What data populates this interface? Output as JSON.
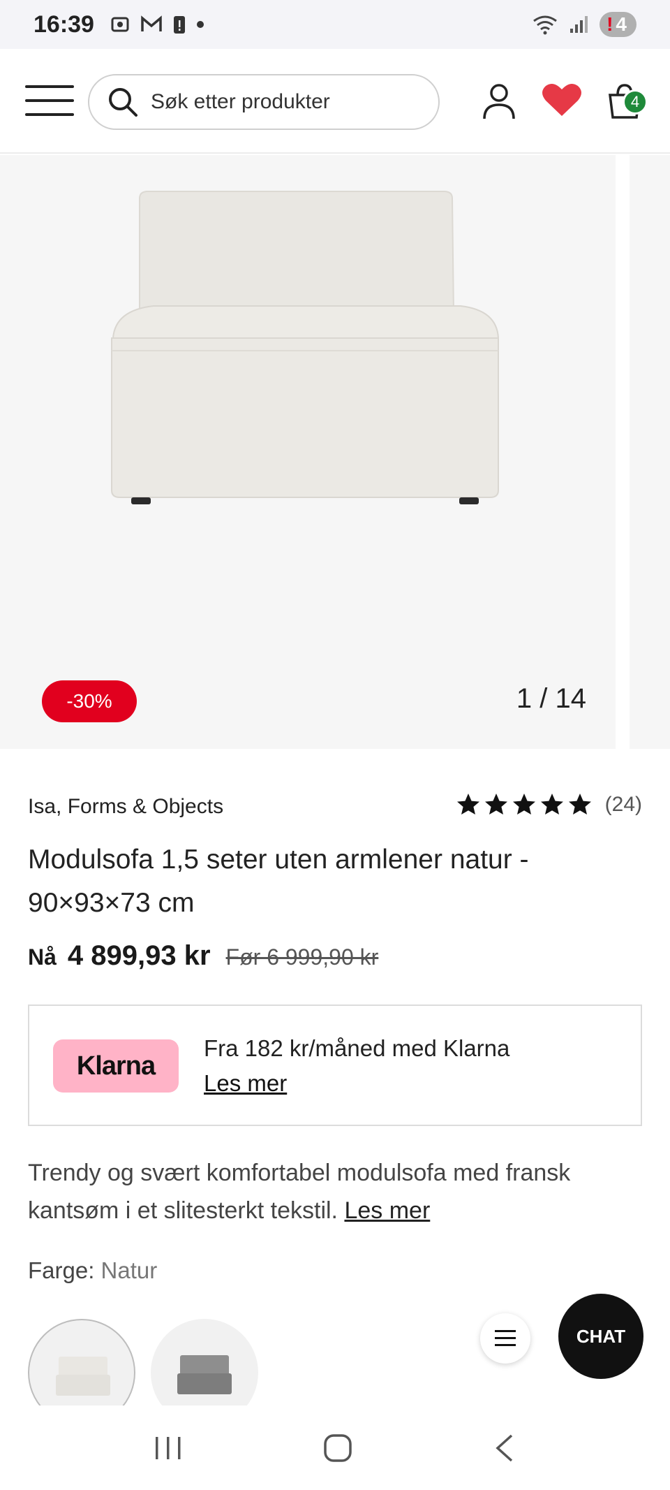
{
  "status_bar": {
    "time": "16:39",
    "battery_level": "4",
    "battery_alert": "!"
  },
  "header": {
    "search": {
      "placeholder": "Søk etter produkter"
    },
    "cart_count": "4"
  },
  "gallery": {
    "discount": "-30%",
    "counter": "1 / 14"
  },
  "product": {
    "brand": "Isa, Forms & Objects",
    "rating": {
      "stars": 5,
      "count": "(24)"
    },
    "title": "Modulsofa 1,5 seter uten armlener natur - 90×93×73 cm",
    "price_prefix": "Nå",
    "price_now": "4 899,93 kr",
    "price_before": "Før 6 999,90 kr",
    "klarna": {
      "logo": "Klarna",
      "text": "Fra 182 kr/måned med Klarna",
      "link": "Les mer"
    },
    "description": "Trendy og svært komfortabel modulsofa med fransk kantsøm i et slitesterkt tekstil.",
    "description_link": "Les mer",
    "color_label": "Farge:",
    "color_value": "Natur"
  },
  "chat": {
    "label": "CHAT"
  },
  "colors": {
    "accent_red": "#e1001e",
    "cart_badge_green": "#1f8a3a",
    "klarna_pink": "#ffb3c7",
    "heart": "#e63946"
  }
}
